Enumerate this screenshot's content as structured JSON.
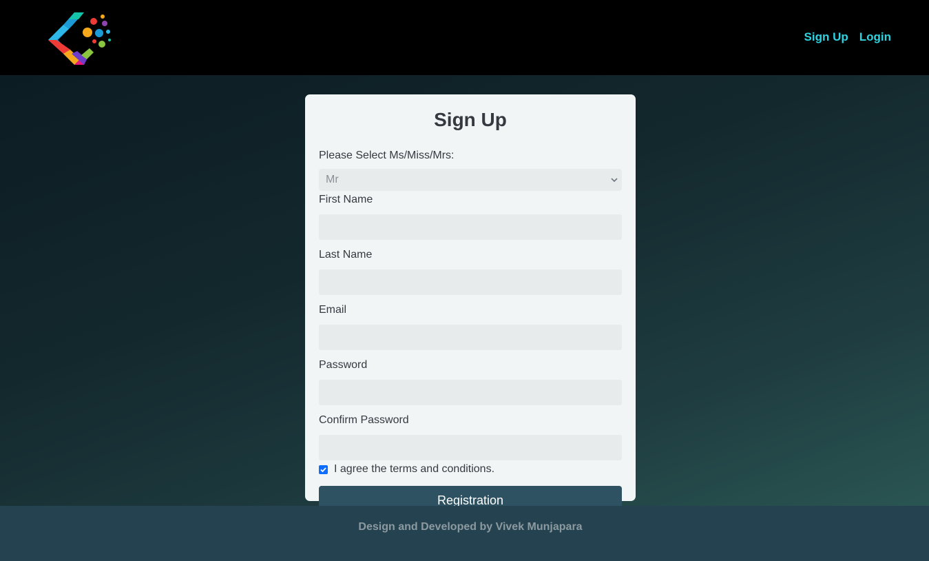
{
  "nav": {
    "links": [
      "Sign Up",
      "Login"
    ]
  },
  "form": {
    "title": "Sign Up",
    "salutation_label": "Please Select Ms/Miss/Mrs:",
    "salutation_value": "Mr",
    "fields": [
      {
        "label": "First Name",
        "value": ""
      },
      {
        "label": "Last Name",
        "value": ""
      },
      {
        "label": "Email",
        "value": ""
      },
      {
        "label": "Password",
        "value": ""
      },
      {
        "label": "Confirm Password",
        "value": ""
      }
    ],
    "terms_label": "I agree the terms and conditions.",
    "terms_checked": true,
    "submit_label": "Registration"
  },
  "footer": {
    "text": "Design and Developed by Vivek Munjapara"
  },
  "icons": {
    "logo": "colorful-c-logo",
    "select_chevron": "chevron-down-icon",
    "checkbox_check": "check-icon"
  },
  "colors": {
    "nav_link": "#2fd3e0",
    "card_bg": "#f1f5f6",
    "button_bg": "#2e5261",
    "checkbox": "#0d6efd"
  }
}
